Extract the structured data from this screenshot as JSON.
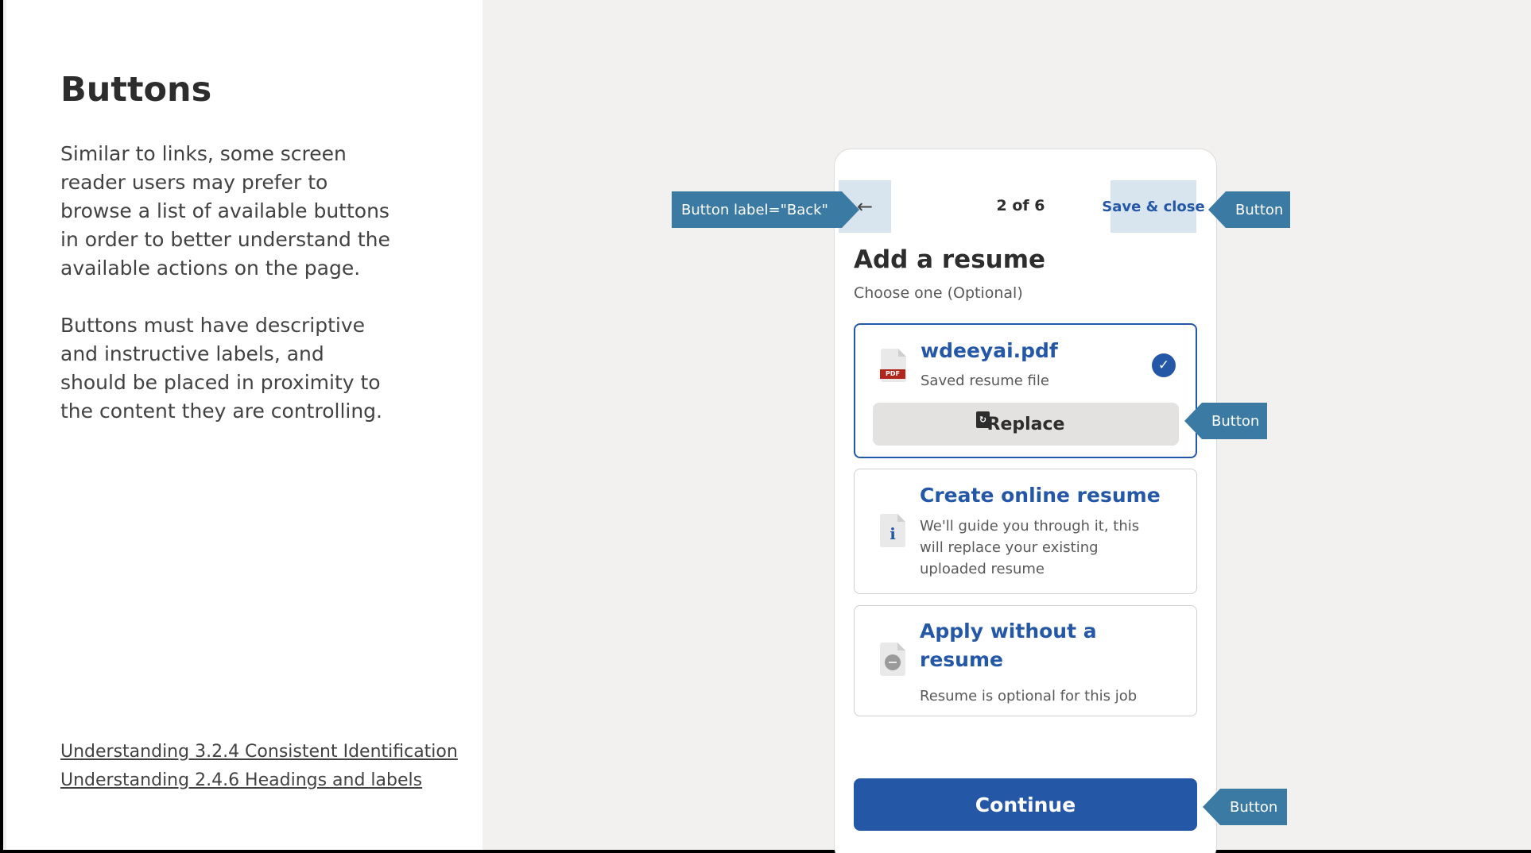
{
  "left_panel": {
    "heading": "Buttons",
    "paragraph_1": "Similar to links, some screen reader users may prefer to browse a list of available buttons in order to better understand the available actions on the page.",
    "paragraph_2": "Buttons must have descriptive and instructive labels, and should be placed in proximity to the content they are controlling.",
    "links": [
      "Understanding 3.2.4 Consistent Identification",
      "Understanding 2.4.6 Headings and labels"
    ]
  },
  "phone": {
    "header": {
      "back_icon": "←",
      "step": "2 of 6",
      "save_label": "Save & close"
    },
    "title": "Add a resume",
    "subtitle": "Choose one (Optional)",
    "options": [
      {
        "title": "wdeeyai.pdf",
        "description": "Saved resume file",
        "icon": "pdf-file-icon",
        "icon_tag": "PDF",
        "check_icon": "✓",
        "selected": true,
        "replace_label": "Replace",
        "replace_icon": "file-refresh-icon"
      },
      {
        "title": "Create online resume",
        "description": "We'll guide you through it, this will replace your existing uploaded resume",
        "icon": "info-file-icon",
        "icon_glyph": "i"
      },
      {
        "title": "Apply without a resume",
        "description": "Resume is optional for this job",
        "icon": "no-file-icon"
      }
    ],
    "continue_label": "Continue"
  },
  "annotations": {
    "back": "Button label=\"Back\"",
    "save": "Button",
    "replace": "Button",
    "continue": "Button"
  },
  "colors": {
    "brand_blue": "#2557a7",
    "annotation_blue": "#3a7aa3",
    "header_button_bg": "#d8e5ee",
    "page_bg": "#f2f1f0"
  }
}
